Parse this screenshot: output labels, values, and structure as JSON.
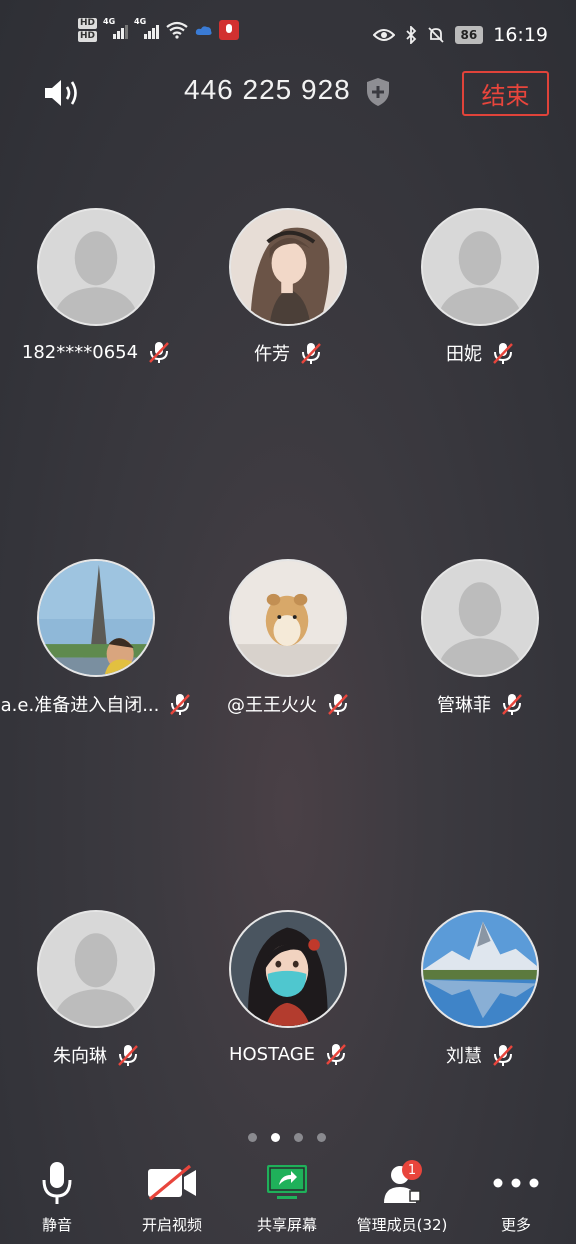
{
  "status_bar": {
    "hd_top": "HD",
    "hd_bottom": "HD",
    "net1": "4G",
    "net2": "4G",
    "battery": "86",
    "time": "16:19",
    "icons": [
      "eye-icon",
      "bluetooth-icon",
      "mute-bell-icon"
    ]
  },
  "header": {
    "meeting_id": "446 225 928",
    "end_label": "结束"
  },
  "participants": [
    {
      "name": "182****0654",
      "avatar": "default"
    },
    {
      "name": "仵芳",
      "avatar": "anime-girl"
    },
    {
      "name": "田妮",
      "avatar": "default"
    },
    {
      "name": "a.e.准备进入自闭...",
      "avatar": "eiffel-tower"
    },
    {
      "name": "@王王火火",
      "avatar": "hamster"
    },
    {
      "name": "管琳菲",
      "avatar": "default"
    },
    {
      "name": "朱向琳",
      "avatar": "default"
    },
    {
      "name": "HOSTAGE",
      "avatar": "masked-girl"
    },
    {
      "name": "刘慧",
      "avatar": "mountain-lake"
    }
  ],
  "pager": {
    "count": 4,
    "active": 1
  },
  "toolbar": {
    "mute": "静音",
    "video": "开启视频",
    "share": "共享屏幕",
    "members": "管理成员(32)",
    "members_badge": "1",
    "more": "更多"
  },
  "colors": {
    "end_red": "#e8453c",
    "share_green": "#1fb15a",
    "muted_red": "#e8453c"
  }
}
